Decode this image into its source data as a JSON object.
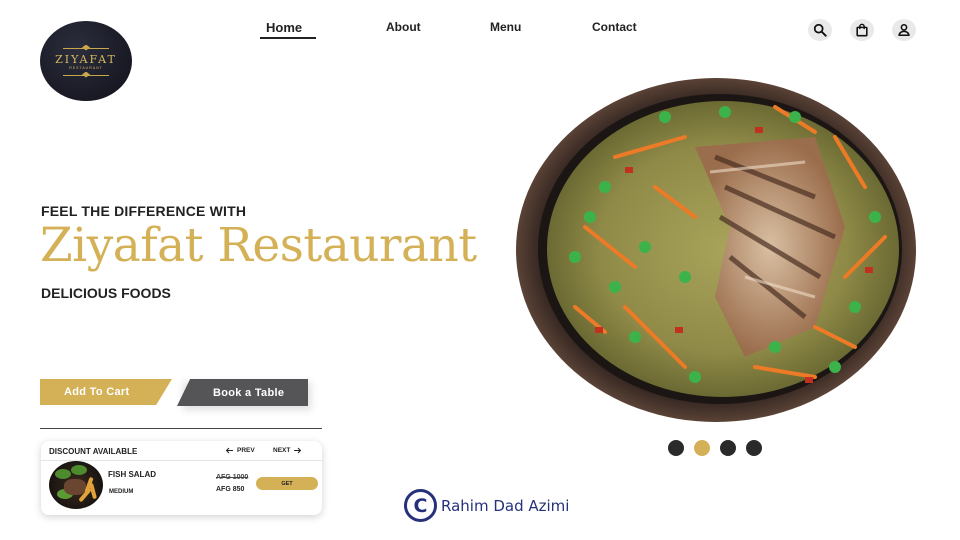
{
  "brand": {
    "logo_name": "ZIYAFAT",
    "logo_sub": "RESTAURANT"
  },
  "nav": {
    "items": [
      "Home",
      "About",
      "Menu",
      "Contact"
    ],
    "active": "Home"
  },
  "header_icons": [
    "search-icon",
    "shopping-bag-icon",
    "user-icon"
  ],
  "hero": {
    "tagline": "FEEL THE DIFFERENCE WITH",
    "headline": "Ziyafat Restaurant",
    "subline": "DELICIOUS FOODS"
  },
  "actions": {
    "add_to_cart": "Add To Cart",
    "book_table": "Book a Table"
  },
  "discount_card": {
    "title": "DISCOUNT AVAILABLE",
    "prev_label": "PREV",
    "next_label": "NEXT",
    "item": {
      "name": "FISH SALAD",
      "size": "MEDIUM",
      "old_price": "AFG 1000",
      "new_price": "AFG 850",
      "button": "GET"
    }
  },
  "carousel": {
    "total": 4,
    "active_index": 1
  },
  "credit": {
    "symbol": "C",
    "text": "Rahim Dad Azimi"
  },
  "colors": {
    "accent_gold": "#d4b157",
    "dark_button": "#555557",
    "credit_blue": "#25317a",
    "text_dark": "#222222"
  }
}
